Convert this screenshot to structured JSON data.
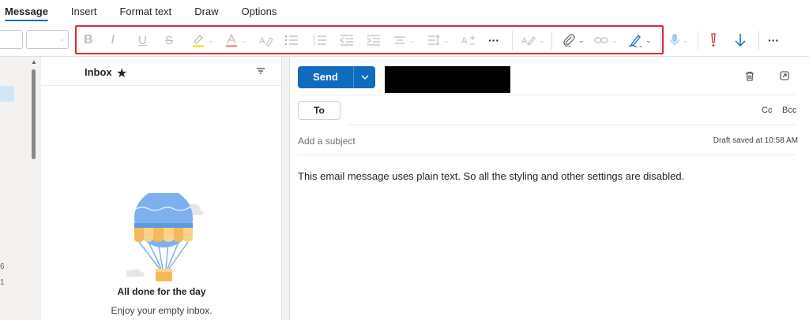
{
  "tabs": [
    {
      "label": "Message",
      "active": true
    },
    {
      "label": "Insert",
      "active": false
    },
    {
      "label": "Format text",
      "active": false
    },
    {
      "label": "Draw",
      "active": false
    },
    {
      "label": "Options",
      "active": false
    }
  ],
  "toolbar": {
    "disabled_color": "#bdbdbd",
    "important_color": "#d13438",
    "low_importance_color": "#0f6cbd",
    "highlight_border_color": "#e0263a",
    "more_label": "···"
  },
  "inbox": {
    "title": "Inbox",
    "empty_title": "All done for the day",
    "empty_subtitle": "Enjoy your empty inbox."
  },
  "rail": {
    "count_a": "6",
    "count_b": "1"
  },
  "compose": {
    "send_label": "Send",
    "to_label": "To",
    "cc_label": "Cc",
    "bcc_label": "Bcc",
    "subject_placeholder": "Add a subject",
    "draft_status": "Draft saved at 10:58 AM",
    "body": "This email message uses plain text. So all the styling and other settings are disabled.",
    "accent": "#0f6cbd"
  }
}
